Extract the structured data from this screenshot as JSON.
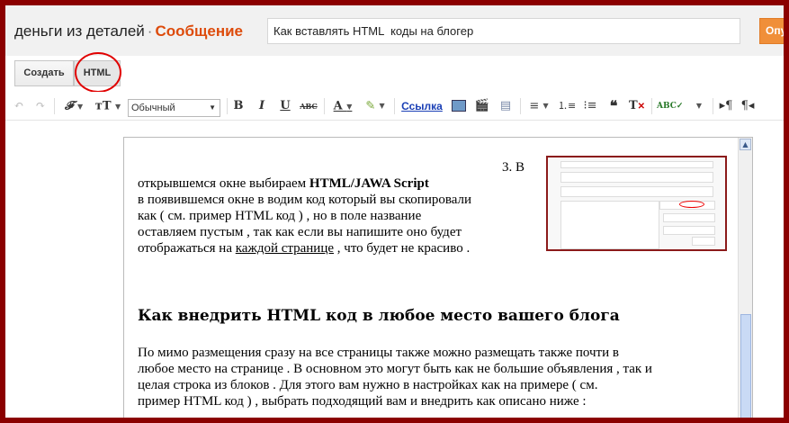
{
  "header": {
    "blog_name": "деньги из деталей",
    "separator": "·",
    "page_kind": "Сообщение",
    "post_title": "Как вставлять HTML  коды на блогер",
    "publish_label": "Опубликовать"
  },
  "tabs": {
    "compose": "Создать",
    "html": "HTML"
  },
  "toolbar": {
    "format_select": "Обычный",
    "link_label": "Ссылка",
    "bold": "B",
    "italic": "I",
    "underline": "U",
    "strike": "ABC"
  },
  "content": {
    "step_number": "3.  В",
    "p1_line1_pre": "открывшемся окне выбираем ",
    "p1_line1_bold": "HTML/JAWA Script",
    "p1_line2": "в появившемся окне в водим код который вы скопировали",
    "p1_line3_pre": "как ( см. пример ",
    "p1_line3_link": "HTML код  ",
    "p1_line3_post": ") , но в поле название",
    "p1_line4": "оставляем пустым , так как если вы напишите оно будет",
    "p1_line5_pre": "отображаться на ",
    "p1_line5_under": "каждой странице",
    "p1_line5_post": " , что будет не красиво .",
    "heading": "Как внедрить HTML код в любое место вашего блога",
    "p2_line1": "По мимо размещения сразу на все страницы также можно размещать также почти в",
    "p2_line2": "любое место на странице . В основном это могут быть как не большие объявления , так и",
    "p2_line3": "целая строка из блоков . Для этого вам нужно в настройках как на примере ( см.",
    "p2_line4_pre": "пример ",
    "p2_line4_link": "HTML код  ",
    "p2_line4_post": ") , выбрать подходящий вам и внедрить как описано ниже :"
  },
  "colors": {
    "frame_border": "#8b0000",
    "accent_orange": "#dd4b0b",
    "link": "#1a3fb5",
    "highlight_circle": "#e00000"
  }
}
